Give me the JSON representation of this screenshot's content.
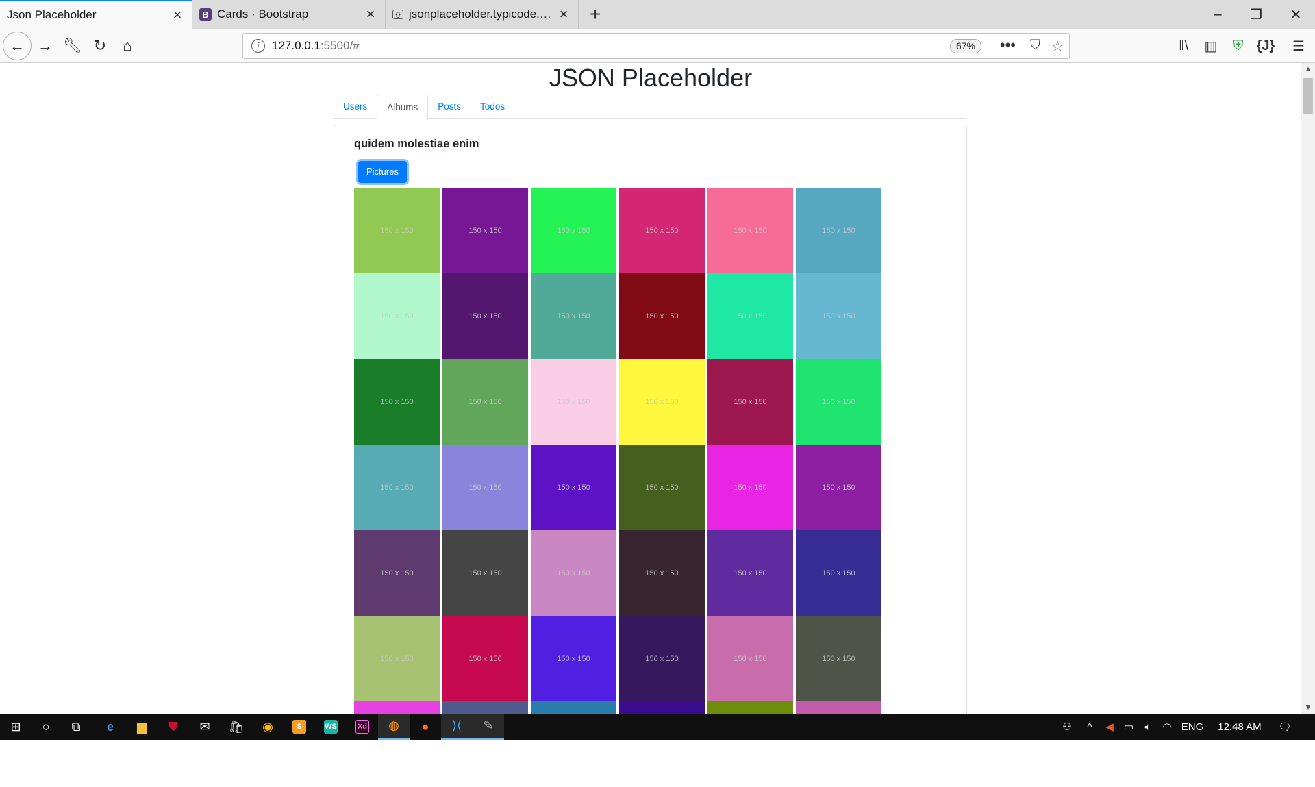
{
  "browser": {
    "tabs": [
      {
        "title": "Json Placeholder",
        "active": true,
        "favicon": "none"
      },
      {
        "title": "Cards · Bootstrap",
        "active": false,
        "favicon": "bootstrap-icon",
        "favicon_letter": "B",
        "favicon_color": "#563d7c"
      },
      {
        "title": "jsonplaceholder.typicode.com/",
        "active": false,
        "favicon": "placeholder-icon"
      }
    ],
    "new_tab_glyph": "+",
    "url_host": "127.0.0.1",
    "url_rest": ":5500/#",
    "zoom": "67%"
  },
  "page": {
    "title": "JSON Placeholder",
    "tabs": [
      {
        "label": "Users",
        "active": false
      },
      {
        "label": "Albums",
        "active": true
      },
      {
        "label": "Posts",
        "active": false
      },
      {
        "label": "Todos",
        "active": false
      }
    ],
    "album_title": "quidem molestiae enim",
    "pictures_button": "Pictures",
    "thumb_label": "150 x 150",
    "thumbs": [
      "#92c952",
      "#771796",
      "#24f355",
      "#d32776",
      "#f66b97",
      "#56a8c2",
      "#b0f7cc",
      "#54176f",
      "#51aa97",
      "#810b14",
      "#1ee8a4",
      "#66b7d2",
      "#197d29",
      "#61a65a",
      "#f9cee5",
      "#fdf73e",
      "#9c184f",
      "#1fe46f",
      "#56acb2",
      "#8985dc",
      "#5e12c6",
      "#45601e",
      "#e924e5",
      "#8e1fa2",
      "#5e3a6f",
      "#454545",
      "#c987c3",
      "#38252f",
      "#602b9e",
      "#372c93",
      "#a7c272",
      "#c70a4f",
      "#501fe1",
      "#35185e",
      "#c96cab",
      "#4e5447",
      "#e741e4",
      "#4f5b8a",
      "#2a7faa",
      "#3c0c8e",
      "#6d8e0a",
      "#c45aac"
    ]
  },
  "taskbar": {
    "language": "ENG",
    "time": "12:48 AM"
  },
  "colors": {
    "accent": "#007bff",
    "firefox_tab_accent": "#0a84ff"
  }
}
